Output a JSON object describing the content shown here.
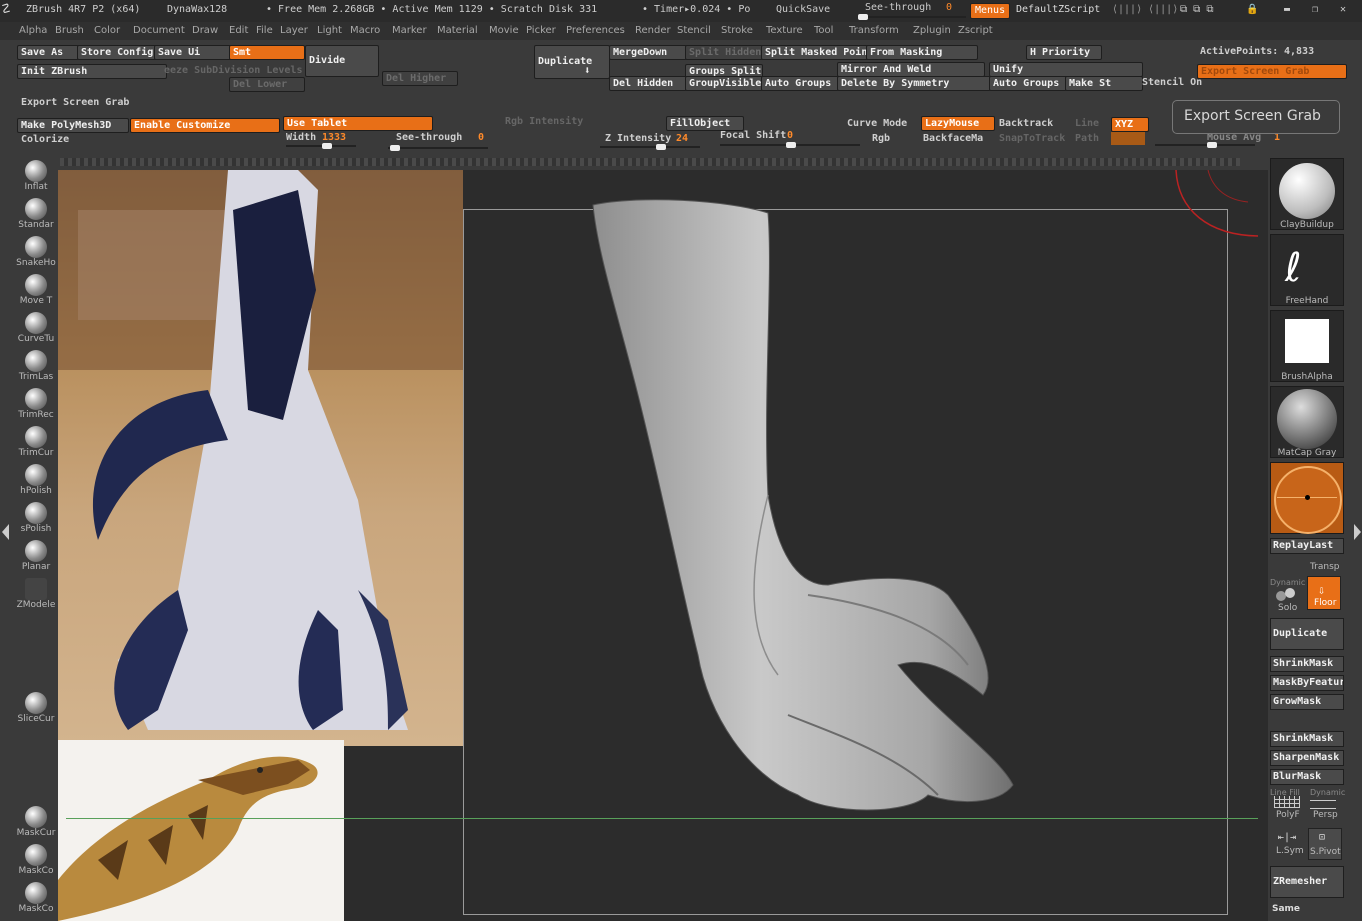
{
  "titlebar": {
    "app": "ZBrush 4R7 P2 (x64)",
    "doc": "DynaWax128",
    "free_mem": "• Free Mem 2.268GB • Active Mem 1129 • Scratch Disk 331",
    "timer": "• Timer▸0.024 • Po",
    "quicksave": "QuickSave",
    "seethrough_label": "See-through",
    "seethrough_value": "0",
    "menus": "Menus",
    "defaultzscript": "DefaultZScript"
  },
  "menubar": [
    "Alpha",
    "Brush",
    "Color",
    "Document",
    "Draw",
    "Edit",
    "File",
    "Layer",
    "Light",
    "Macro",
    "Marker",
    "Material",
    "Movie",
    "Picker",
    "Preferences",
    "Render",
    "Stencil",
    "Stroke",
    "Texture",
    "Tool",
    "Transform",
    "Zplugin",
    "Zscript"
  ],
  "toolbar": {
    "save_as": "Save As",
    "store_config": "Store Config",
    "save_ui": "Save Ui",
    "smt": "Smt",
    "divide": "Divide",
    "init_zbrush": "Init ZBrush",
    "subdiv": "eeze SubDivision Levels",
    "del_lower": "Del Lower",
    "del_higher": "Del Higher",
    "export_screen_grab": "Export Screen Grab",
    "make_polymesh": "Make PolyMesh3D",
    "enable_customize": "Enable Customize",
    "use_tablet": "Use Tablet",
    "colorize": "Colorize",
    "width_label": "Width",
    "width_value": "1333",
    "see_through_label": "See-through",
    "see_through_value": "0",
    "duplicate": "Duplicate",
    "merge_down": "MergeDown",
    "split_hidden": "Split Hidden",
    "split_masked": "Split Masked Points",
    "from_masking": "From Masking",
    "h_priority": "H Priority",
    "groups_split": "Groups Split",
    "mirror_weld": "Mirror And Weld",
    "unify": "Unify",
    "del_hidden": "Del Hidden",
    "group_visible": "GroupVisible",
    "auto_groups": "Auto Groups",
    "delete_symmetry": "Delete By Symmetry",
    "auto_groups2": "Auto Groups",
    "make_st": "Make St",
    "stencil_on": "Stencil On",
    "active_points_label": "ActivePoints:",
    "active_points_value": "4,833",
    "rgb_intensity": "Rgb Intensity",
    "fill_object": "FillObject",
    "z_intensity_label": "Z Intensity",
    "z_intensity_value": "24",
    "focal_shift_label": "Focal Shift",
    "focal_shift_value": "0",
    "curve_mode": "Curve Mode",
    "lazymouse": "LazyMouse",
    "backtrack": "Backtrack",
    "line": "Line",
    "xyz": "XYZ",
    "rgb": "Rgb",
    "backface": "BackfaceMa",
    "snaptotrack": "SnapToTrack",
    "path": "Path",
    "mouse_avg": "Mouse Avg",
    "mouse_avg_value": "1",
    "tooltip": "Export Screen Grab"
  },
  "left_brushes": [
    {
      "name": "Inflat",
      "icon": "inflate-brush-icon"
    },
    {
      "name": "Standar",
      "icon": "standard-brush-icon"
    },
    {
      "name": "SnakeHo",
      "icon": "snakehook-brush-icon"
    },
    {
      "name": "Move T",
      "icon": "move-brush-icon"
    },
    {
      "name": "CurveTu",
      "icon": "curvetube-brush-icon"
    },
    {
      "name": "TrimLas",
      "icon": "trimlasso-brush-icon"
    },
    {
      "name": "TrimRec",
      "icon": "trimrect-brush-icon"
    },
    {
      "name": "TrimCur",
      "icon": "trimcurve-brush-icon"
    },
    {
      "name": "hPolish",
      "icon": "hpolish-brush-icon"
    },
    {
      "name": "sPolish",
      "icon": "spolish-brush-icon"
    },
    {
      "name": "Planar",
      "icon": "planar-brush-icon"
    },
    {
      "name": "ZModele",
      "icon": "zmodeler-brush-icon"
    },
    {
      "name": "SliceCur",
      "icon": "slicecurve-brush-icon"
    },
    {
      "name": "MaskCur",
      "icon": "maskcurve-brush-icon"
    },
    {
      "name": "MaskCo",
      "icon": "maskcircle-brush-icon"
    },
    {
      "name": "MaskCo",
      "icon": "masklasso-brush-icon"
    }
  ],
  "right_shelf": {
    "claybuildup": "ClayBuildup",
    "freehand": "FreeHand",
    "brushalpha": "BrushAlpha",
    "matcap": "MatCap Gray",
    "replaylast": "ReplayLast",
    "transp": "Transp",
    "dynamic": "Dynamic",
    "solo": "Solo",
    "floor": "Floor",
    "duplicate": "Duplicate",
    "shrinkmask": "ShrinkMask",
    "maskbyfeature": "MaskByFeature",
    "growmask": "GrowMask",
    "shrinkmask2": "ShrinkMask",
    "sharpenmask": "SharpenMask",
    "blurmask": "BlurMask",
    "linefill": "Line Fill",
    "polyf": "PolyF",
    "dynamic2": "Dynamic",
    "persp": "Persp",
    "lsym": "L.Sym",
    "spivot": "S.Pivot",
    "zremesher": "ZRemesher",
    "same": "Same"
  },
  "colors": {
    "accent": "#e86f17",
    "bg": "#3a3a3a",
    "canvas": "#2c2c2c"
  }
}
